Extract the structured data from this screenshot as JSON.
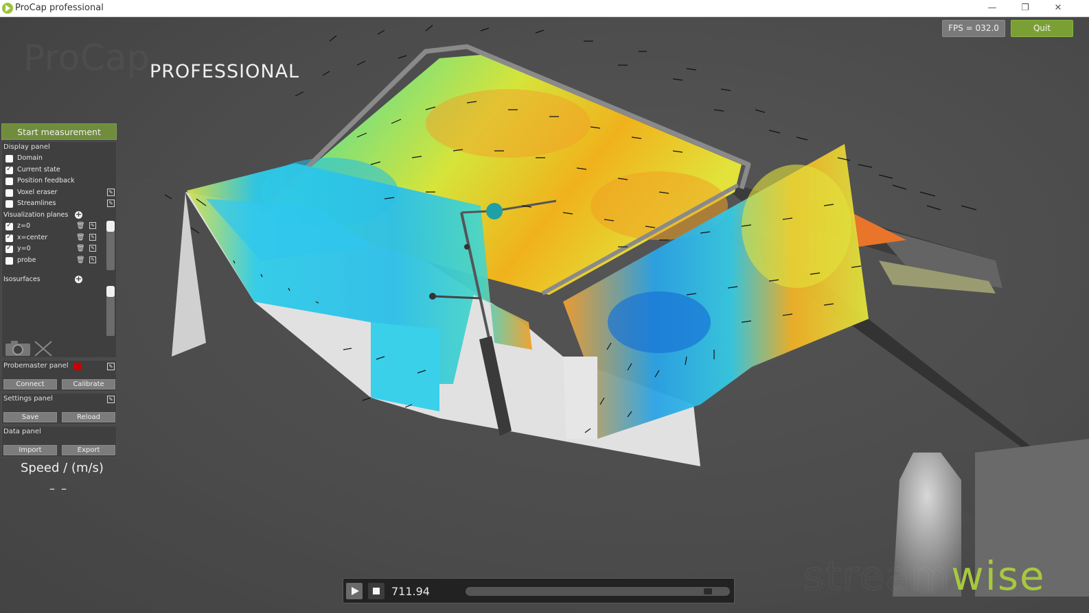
{
  "window": {
    "title": "ProCap professional",
    "minimize": "—",
    "restore": "❐",
    "close": "✕"
  },
  "brand": {
    "faint": "ProCap",
    "tagline": "PROFESSIONAL"
  },
  "header": {
    "fps": "FPS = 032.0",
    "quit": "Quit"
  },
  "left": {
    "start_measurement": "Start measurement",
    "display_panel": {
      "title": "Display panel",
      "items": [
        {
          "label": "Domain",
          "checked": false
        },
        {
          "label": "Current state",
          "checked": true
        },
        {
          "label": "Position feedback",
          "checked": false
        },
        {
          "label": "Voxel eraser",
          "checked": false
        },
        {
          "label": "Streamlines",
          "checked": false
        }
      ],
      "visualization_planes_title": "Visualization planes",
      "planes": [
        {
          "label": "z=0",
          "checked": true
        },
        {
          "label": "x=center",
          "checked": true
        },
        {
          "label": "y=0",
          "checked": true
        },
        {
          "label": "probe",
          "checked": false
        }
      ],
      "isosurfaces_title": "Isosurfaces"
    },
    "probemaster": {
      "title": "Probemaster panel",
      "connect": "Connect",
      "calibrate": "Calibrate",
      "status_color": "#cc0000"
    },
    "settings": {
      "title": "Settings panel",
      "save": "Save",
      "reload": "Reload"
    },
    "data": {
      "title": "Data panel",
      "import": "Import",
      "export": "Export"
    },
    "speed": {
      "title": "Speed / (m/s)",
      "value": "– –"
    }
  },
  "player": {
    "time": "711.94",
    "progress": 0.93
  },
  "watermark": {
    "part1": "stream",
    "part2": "wise"
  },
  "colors": {
    "accent_green": "#7aa035",
    "viewport": "#4b4b4b"
  }
}
